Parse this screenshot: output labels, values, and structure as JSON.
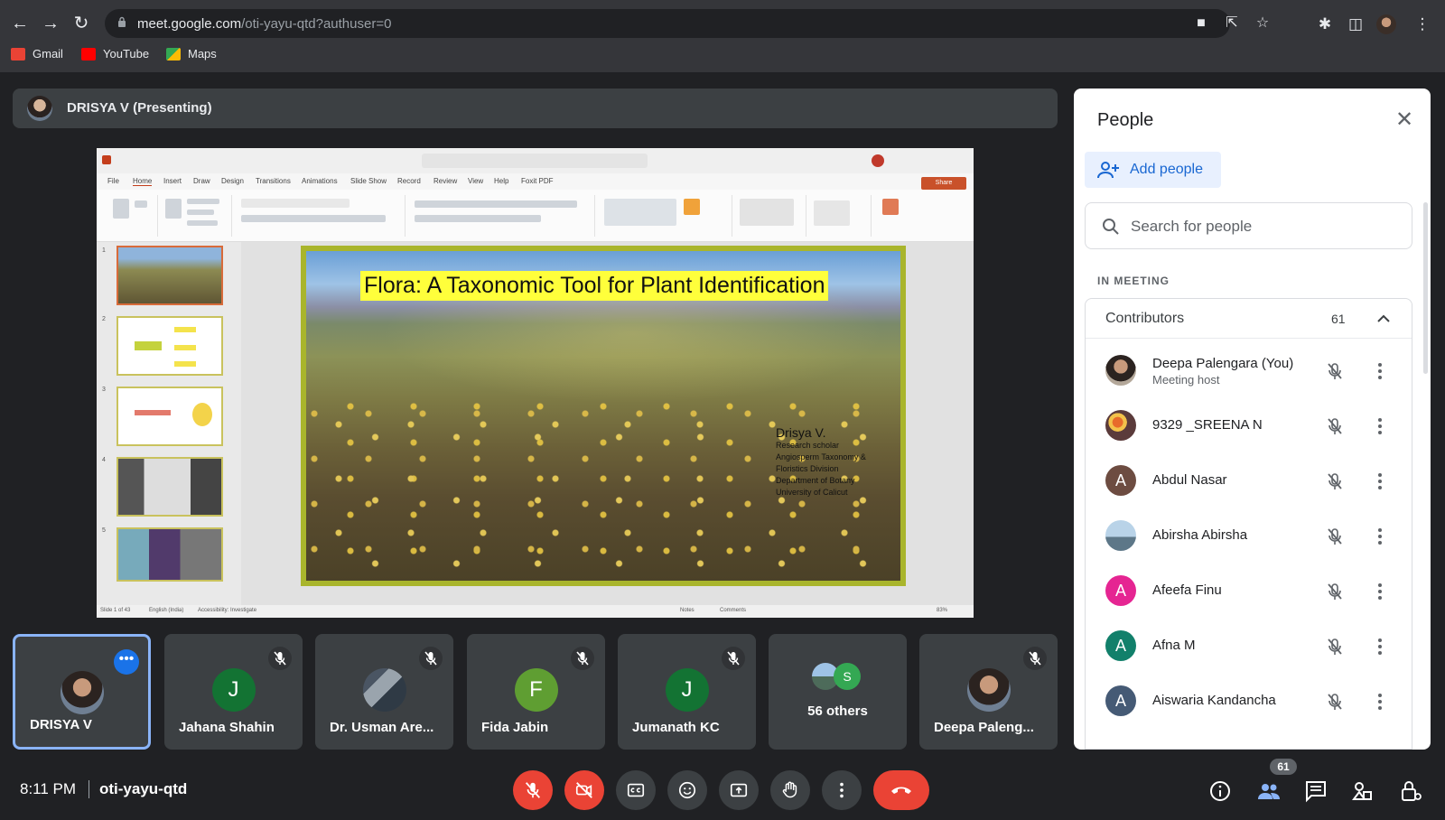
{
  "browser": {
    "url_host": "meet.google.com",
    "url_path": "/oti-yayu-qtd?authuser=0",
    "bookmarks": [
      {
        "label": "Gmail",
        "color": "#ea4335"
      },
      {
        "label": "YouTube",
        "color": "#ff0000"
      },
      {
        "label": "Maps",
        "color": "#34a853"
      }
    ]
  },
  "presenter": {
    "label": "DRISYA V (Presenting)"
  },
  "presentation": {
    "menu": [
      "File",
      "Home",
      "Insert",
      "Draw",
      "Design",
      "Transitions",
      "Animations",
      "Slide Show",
      "Record",
      "Review",
      "View",
      "Help",
      "Foxit PDF"
    ],
    "share_label": "Share",
    "slide_title": "Flora: A Taxonomic Tool for Plant Identification",
    "author_name": "Drisya V.",
    "author_lines": [
      "Research scholar",
      "Angiosperm Taxonomy &",
      "Floristics Division",
      "Department of Botany",
      "University of Calicut"
    ],
    "thumb_numbers": [
      "1",
      "2",
      "3",
      "4",
      "5"
    ],
    "status": {
      "slide": "Slide 1 of 43",
      "language": "English (India)",
      "accessibility": "Accessibility: Investigate",
      "notes": "Notes",
      "comments": "Comments",
      "zoom": "83%"
    }
  },
  "tiles": [
    {
      "name": "DRISYA V",
      "type": "photo"
    },
    {
      "name": "Jahana Shahin",
      "initial": "J",
      "color": "#137333"
    },
    {
      "name": "Dr. Usman Are...",
      "type": "photo"
    },
    {
      "name": "Fida Jabin",
      "initial": "F",
      "color": "#5f9e32"
    },
    {
      "name": "Jumanath KC",
      "initial": "J",
      "color": "#137333"
    },
    {
      "name": "56 others",
      "initial": "S",
      "color": "#34a853"
    },
    {
      "name": "Deepa Paleng...",
      "type": "photo"
    }
  ],
  "people_panel": {
    "title": "People",
    "add_people": "Add people",
    "search_placeholder": "Search for people",
    "section": "IN MEETING",
    "group_label": "Contributors",
    "group_count": "61",
    "participants": [
      {
        "name": "Deepa Palengara (You)",
        "role": "Meeting host",
        "avatar": "photo"
      },
      {
        "name": "9329 _SREENA N",
        "avatar": "photo-flower"
      },
      {
        "name": "Abdul Nasar",
        "initial": "A",
        "color": "#6d4c41"
      },
      {
        "name": "Abirsha Abirsha",
        "avatar": "photo-sky"
      },
      {
        "name": "Afeefa Finu",
        "initial": "A",
        "color": "#e52592"
      },
      {
        "name": "Afna M",
        "initial": "A",
        "color": "#12806b"
      },
      {
        "name": "Aiswaria Kandancha",
        "initial": "A",
        "color": "#455a75"
      }
    ]
  },
  "bottom_bar": {
    "time": "8:11 PM",
    "meeting_code": "oti-yayu-qtd",
    "people_count": "61"
  }
}
